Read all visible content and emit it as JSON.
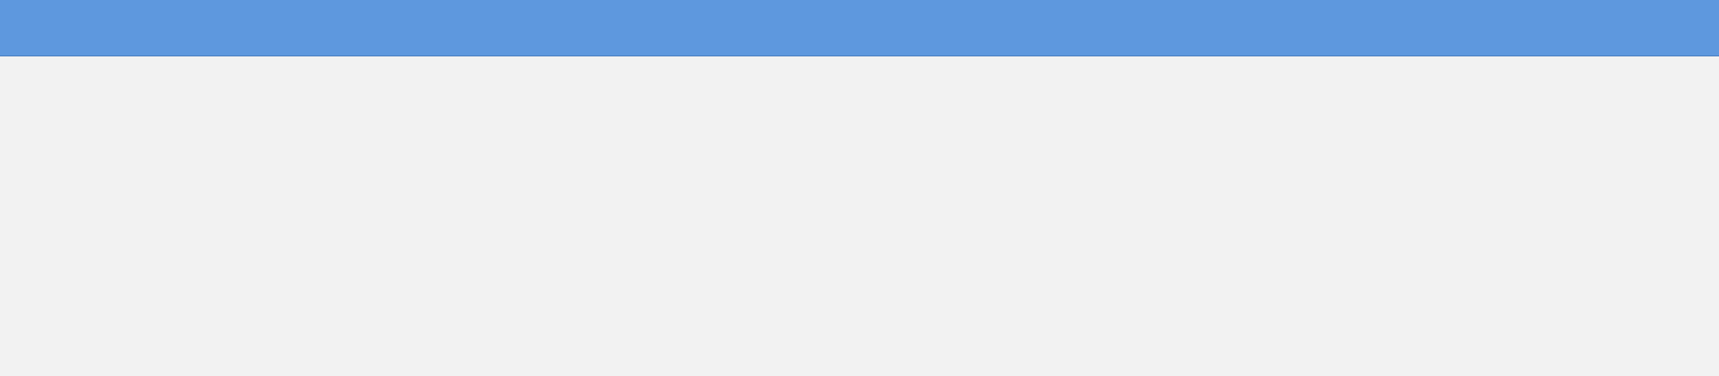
{
  "colors": {
    "header_background": "#5e98de",
    "header_border": "#4a7fbf",
    "content_background": "#f2f2f2"
  }
}
